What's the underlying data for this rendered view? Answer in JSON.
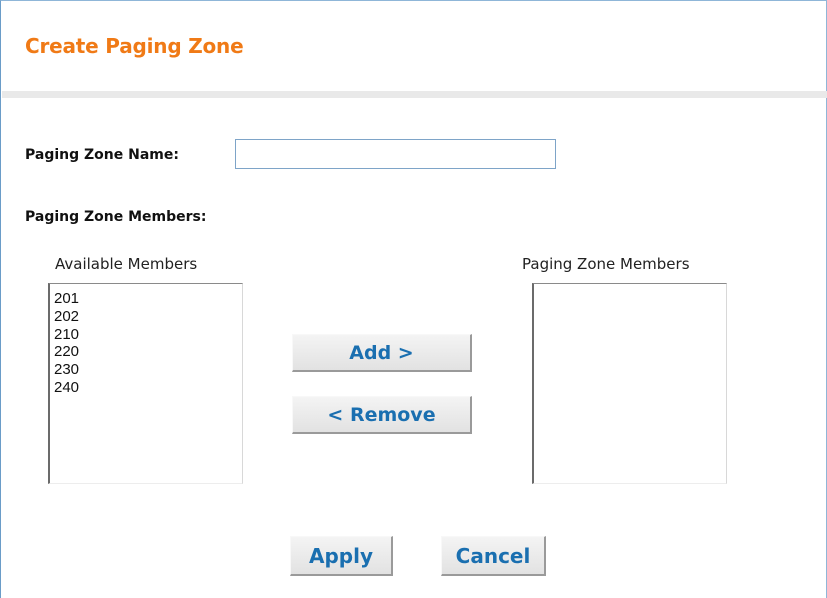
{
  "form": {
    "title": "Create Paging Zone",
    "zone_name_label": "Paging Zone Name:",
    "zone_name_value": "",
    "members_label": "Paging Zone Members:"
  },
  "available": {
    "caption": "Available Members",
    "items": [
      "201",
      "202",
      "210",
      "220",
      "230",
      "240"
    ]
  },
  "selected": {
    "caption": "Paging Zone Members",
    "items": []
  },
  "buttons": {
    "add": "Add >",
    "remove": "< Remove",
    "apply": "Apply",
    "cancel": "Cancel"
  },
  "colors": {
    "title": "#f07a16",
    "button_text": "#1a6fb0",
    "frame_border": "#6a9cc8"
  }
}
